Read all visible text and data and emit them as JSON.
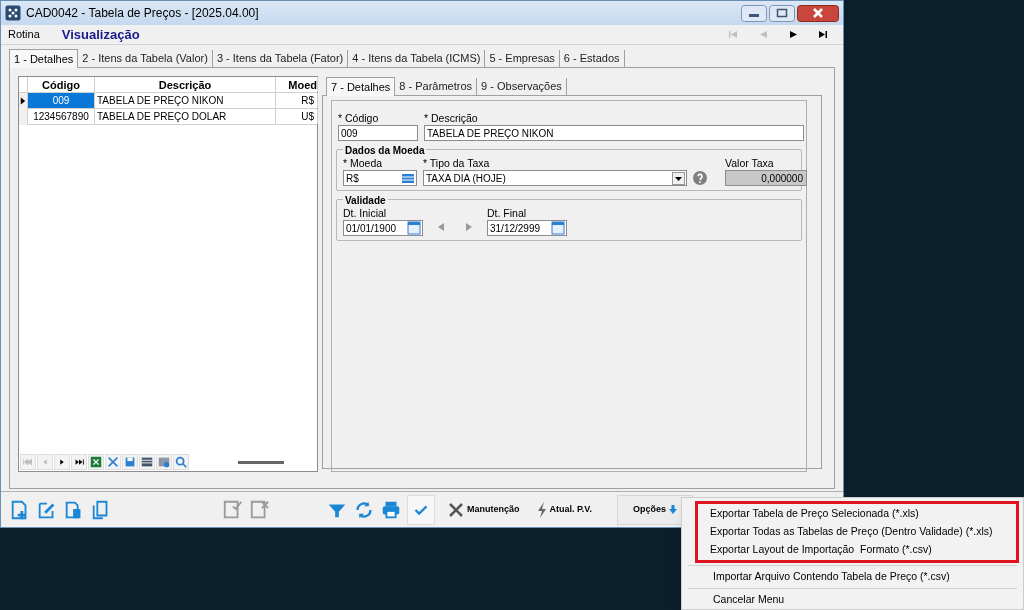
{
  "window": {
    "title": "CAD0042 - Tabela de Preços - [2025.04.00]"
  },
  "menu": [
    {
      "label": "Rotina",
      "kind": "menu"
    },
    {
      "label": "Visualização",
      "kind": "mode"
    }
  ],
  "record_nav": [
    {
      "kind": "first",
      "disabled": true
    },
    {
      "kind": "prev",
      "disabled": true
    },
    {
      "kind": "next",
      "disabled": false
    },
    {
      "kind": "last",
      "disabled": false
    }
  ],
  "tabs": [
    {
      "label": "1 - Detalhes",
      "selected": true
    },
    {
      "label": "2 - Itens da Tabela (Valor)",
      "selected": false
    },
    {
      "label": "3 - Itens da Tabela (Fator)",
      "selected": false
    },
    {
      "label": "4 - Itens da Tabela (ICMS)",
      "selected": false
    },
    {
      "label": "5 - Empresas",
      "selected": false
    },
    {
      "label": "6 - Estados",
      "selected": false
    }
  ],
  "grid": {
    "columns": [
      "Código",
      "Descrição",
      "Moed"
    ],
    "rows": [
      {
        "cells": [
          "009",
          "TABELA DE PREÇO NIKON",
          "R$"
        ],
        "selected": true
      },
      {
        "cells": [
          "1234567890",
          "TABELA DE PREÇO DOLAR",
          "U$"
        ],
        "selected": false
      }
    ]
  },
  "detail_tabs": [
    {
      "label": "7 - Detalhes",
      "selected": true
    },
    {
      "label": "8 - Parâmetros",
      "selected": false
    },
    {
      "label": "9 - Observações",
      "selected": false
    }
  ],
  "form": {
    "codigo": {
      "label": "* Código",
      "value": "009"
    },
    "descricao": {
      "label": "* Descrição",
      "value": "TABELA DE PREÇO NIKON"
    },
    "currency_group": {
      "title": "Dados da Moeda",
      "moeda": {
        "label": "* Moeda",
        "value": "R$"
      },
      "tipo_taxa": {
        "label": "* Tipo da Taxa",
        "value": "TAXA DIA (HOJE)"
      },
      "valor_taxa": {
        "label": "Valor Taxa",
        "value": "0,000000"
      }
    },
    "validity_group": {
      "title": "Validade",
      "dt_inicial": {
        "label": "Dt. Inicial",
        "value": "01/01/1900"
      },
      "dt_final": {
        "label": "Dt. Final",
        "value": "31/12/2999"
      }
    }
  },
  "toolbar": {
    "icon_buttons": [
      {
        "kind": "new",
        "disabled": false
      },
      {
        "kind": "edit",
        "disabled": false
      },
      {
        "kind": "delete",
        "disabled": false
      },
      {
        "kind": "copy",
        "disabled": false
      },
      {
        "kind": "save",
        "disabled": true
      },
      {
        "kind": "cancel",
        "disabled": true
      },
      {
        "kind": "filter",
        "disabled": false
      },
      {
        "kind": "refresh",
        "disabled": false
      },
      {
        "kind": "print",
        "disabled": false
      },
      {
        "kind": "confirm",
        "disabled": false
      }
    ],
    "buttons": [
      {
        "label": "Manutenção",
        "kind": "tools"
      },
      {
        "label": "Atual. P.V.",
        "kind": "bolt"
      },
      {
        "label": "Opções",
        "kind": "dropdown"
      }
    ]
  },
  "context_menu": {
    "sections": [
      {
        "highlighted": true,
        "items": [
          "Exportar Tabela de Preço Selecionada (*.xls)",
          "Exportar Todas as Tabelas de Preço (Dentro Validade) (*.xls)",
          "Exportar Layout de Importação  Formato (*.csv)"
        ]
      },
      {
        "highlighted": false,
        "items": [
          "Importar Arquivo Contendo Tabela de Preço (*.csv)"
        ]
      },
      {
        "highlighted": false,
        "items": [
          "Cancelar Menu"
        ]
      }
    ]
  }
}
